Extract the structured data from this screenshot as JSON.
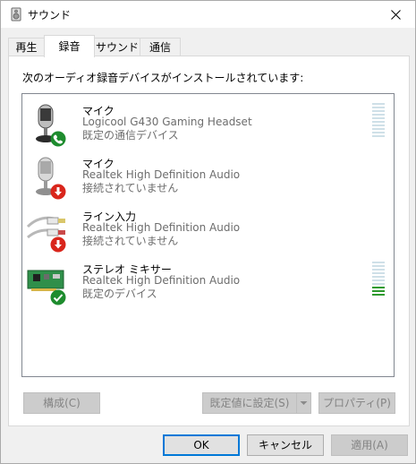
{
  "window": {
    "title": "サウンド"
  },
  "tabs": [
    {
      "label": "再生",
      "active": false
    },
    {
      "label": "録音",
      "active": true
    },
    {
      "label": "サウンド",
      "active": false
    },
    {
      "label": "通信",
      "active": false
    }
  ],
  "panel": {
    "instruction": "次のオーディオ録音デバイスがインストールされています:"
  },
  "devices": [
    {
      "name": "マイク",
      "description": "Logicool G430 Gaming Headset",
      "status": "既定の通信デバイス",
      "status_icon": "phone-icon",
      "status_color": "#1e8c2e",
      "meter_level": 0
    },
    {
      "name": "マイク",
      "description": "Realtek High Definition Audio",
      "status": "接続されていません",
      "status_icon": "down-arrow-icon",
      "status_color": "#d9261c"
    },
    {
      "name": "ライン入力",
      "description": "Realtek High Definition Audio",
      "status": "接続されていません",
      "status_icon": "down-arrow-icon",
      "status_color": "#d9261c"
    },
    {
      "name": "ステレオ ミキサー",
      "description": "Realtek High Definition Audio",
      "status": "既定のデバイス",
      "status_icon": "checkmark-icon",
      "status_color": "#1e8c2e",
      "meter_level": 0.3
    }
  ],
  "panel_buttons": {
    "configure": "構成(C)",
    "set_default": "既定値に設定(S)",
    "properties": "プロパティ(P)"
  },
  "dialog_buttons": {
    "ok": "OK",
    "cancel": "キャンセル",
    "apply": "適用(A)"
  }
}
